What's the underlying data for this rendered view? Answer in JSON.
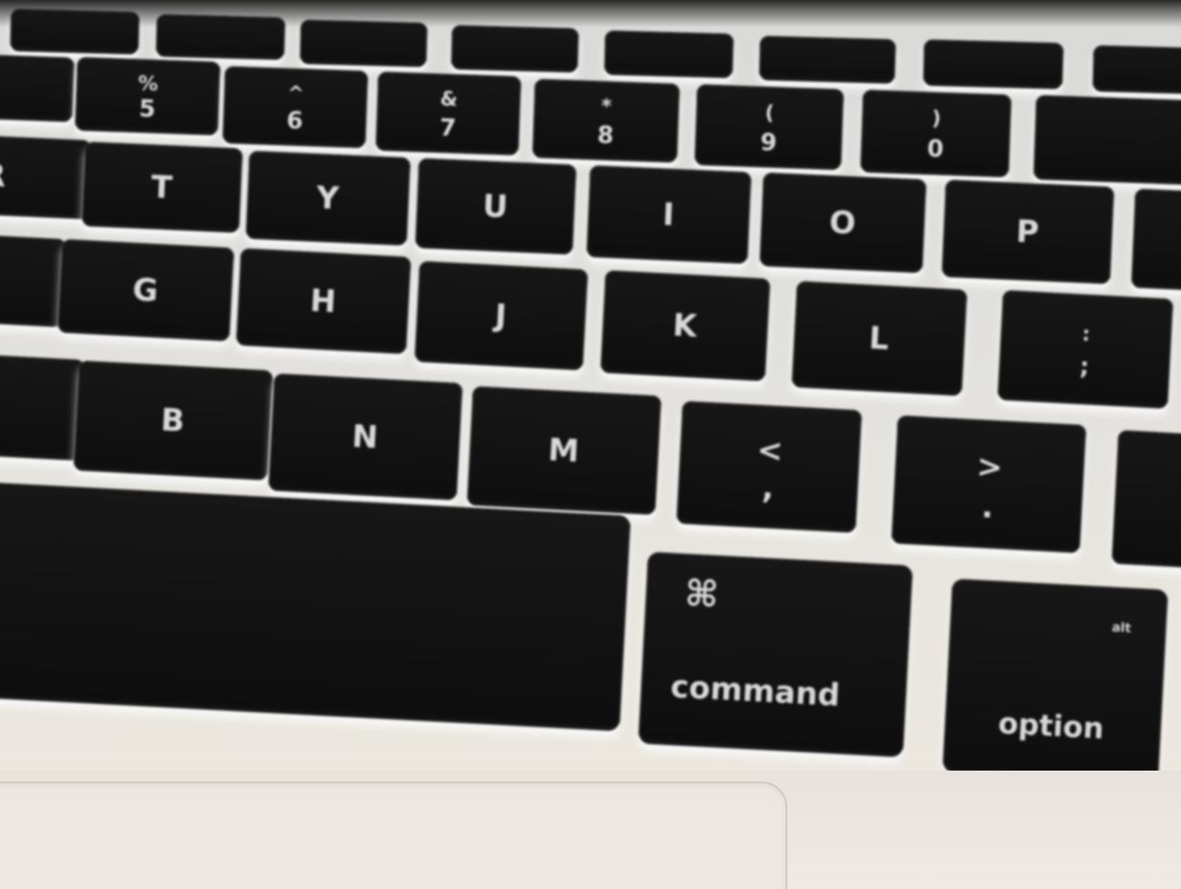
{
  "keyboard": {
    "fn_row": [
      "",
      "",
      "",
      "",
      "",
      "",
      "",
      ""
    ],
    "number_row": [
      {
        "top": "%",
        "bottom": "5"
      },
      {
        "top": "^",
        "bottom": "6"
      },
      {
        "top": "&",
        "bottom": "7"
      },
      {
        "top": "*",
        "bottom": "8"
      },
      {
        "top": "(",
        "bottom": "9"
      },
      {
        "top": ")",
        "bottom": "0"
      },
      {
        "top": "",
        "bottom": ""
      }
    ],
    "top_letter_row": [
      "R",
      "T",
      "Y",
      "U",
      "I",
      "O",
      "P"
    ],
    "home_row": [
      "G",
      "H",
      "J",
      "K",
      "L"
    ],
    "semicolon_key": {
      "top": ":",
      "bottom": ";"
    },
    "bottom_letter_row": [
      "B",
      "N",
      "M"
    ],
    "comma_key": {
      "top": "<",
      "bottom": ","
    },
    "period_key": {
      "top": ">",
      "bottom": "."
    },
    "command_key": {
      "symbol": "⌘",
      "label": "command"
    },
    "option_key": {
      "symbol": "alt",
      "label": "option"
    }
  }
}
